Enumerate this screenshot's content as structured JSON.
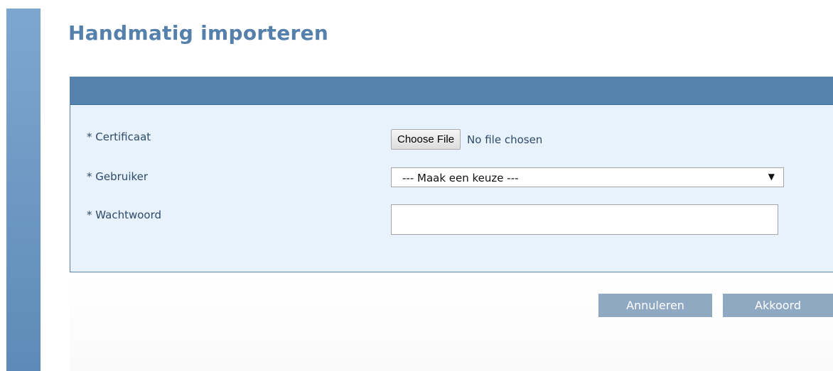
{
  "page": {
    "title": "Handmatig importeren"
  },
  "form": {
    "certificate": {
      "label": "* Certificaat",
      "button_label": "Choose File",
      "status": "No file chosen"
    },
    "user": {
      "label": "* Gebruiker",
      "selected": "--- Maak een keuze ---",
      "arrow": "▼"
    },
    "password": {
      "label": "* Wachtwoord",
      "value": ""
    }
  },
  "actions": {
    "cancel_label": "Annuleren",
    "ok_label": "Akkoord"
  },
  "colors": {
    "title": "#5580ab",
    "header": "#5683ad",
    "panel_bg": "#e8f2fc",
    "button_bg": "#8fa9c3",
    "sidebar": "#6f9ac6"
  }
}
